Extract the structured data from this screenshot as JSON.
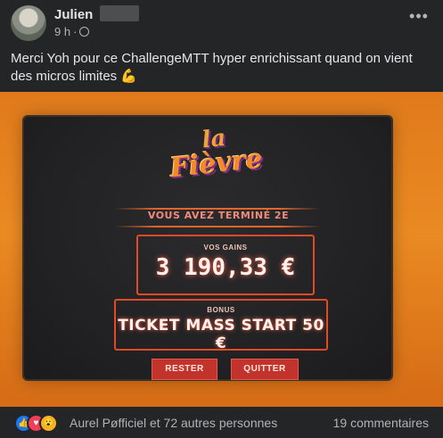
{
  "post": {
    "author": "Julien",
    "time": "9 h",
    "separator": "·",
    "more_label": "•••",
    "text": "Merci Yoh pour ce ChallengeMTT hyper enrichissant quand on vient des micros limites",
    "emoji": "💪"
  },
  "photo": {
    "logo_line1": "la",
    "logo_line2": "Fièvre",
    "finish_text": "VOUS AVEZ TERMINÉ 2E",
    "gains_label": "VOS GAINS",
    "gains_value": "3 190,33 €",
    "bonus_label": "BONUS",
    "bonus_value": "TICKET MASS START 50 €",
    "button_rester": "RESTER",
    "button_quitter": "QUITTER"
  },
  "footer": {
    "reactions_text": "Aurel Pøfficiel et 72 autres personnes",
    "comments_text": "19 commentaires",
    "icons": [
      "like-icon",
      "love-icon",
      "wow-icon"
    ]
  },
  "colors": {
    "background": "#242526",
    "accent_orange": "#e07a1c",
    "game_red": "#c2332c",
    "like_blue": "#1877f2"
  }
}
